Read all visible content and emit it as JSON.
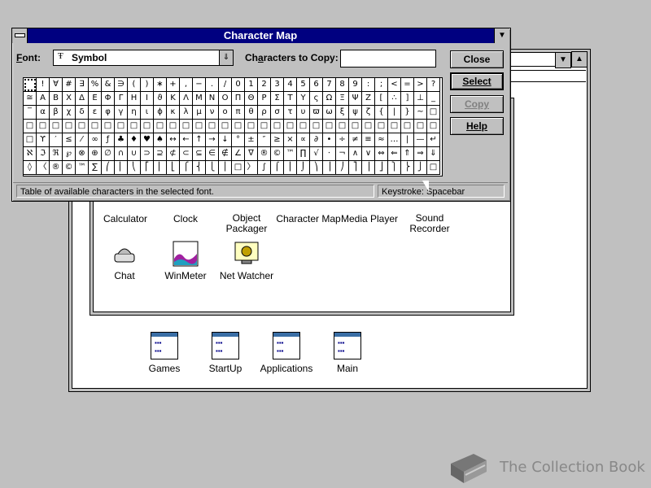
{
  "character_map": {
    "title": "Character Map",
    "font_label_prefix": "F",
    "font_label_rest": "ont:",
    "font_value": "Symbol",
    "font_icon": "truetype-icon",
    "copy_label_prefix": "Ch",
    "copy_label_u": "a",
    "copy_label_rest": "racters to Copy:",
    "copy_value": "",
    "buttons": {
      "close": "Close",
      "select": "Select",
      "copy": "Copy",
      "help": "Help"
    },
    "status": "Table of available characters in the selected font.",
    "keystroke": "Keystroke: Spacebar",
    "grid_rows": [
      [
        " ",
        "!",
        "∀",
        "#",
        "∃",
        "%",
        "&",
        "∋",
        "(",
        ")",
        "∗",
        "+",
        ",",
        "−",
        ".",
        "/",
        "0",
        "1",
        "2",
        "3",
        "4",
        "5",
        "6",
        "7",
        "8",
        "9",
        ":",
        ";",
        "<",
        "=",
        ">",
        "?"
      ],
      [
        "≅",
        "Α",
        "Β",
        "Χ",
        "Δ",
        "Ε",
        "Φ",
        "Γ",
        "Η",
        "Ι",
        "ϑ",
        "Κ",
        "Λ",
        "Μ",
        "Ν",
        "Ο",
        "Π",
        "Θ",
        "Ρ",
        "Σ",
        "Τ",
        "Υ",
        "ς",
        "Ω",
        "Ξ",
        "Ψ",
        "Ζ",
        "[",
        "∴",
        "]",
        "⊥",
        "_"
      ],
      [
        "‾",
        "α",
        "β",
        "χ",
        "δ",
        "ε",
        "φ",
        "γ",
        "η",
        "ι",
        "ϕ",
        "κ",
        "λ",
        "μ",
        "ν",
        "ο",
        "π",
        "θ",
        "ρ",
        "σ",
        "τ",
        "υ",
        "ϖ",
        "ω",
        "ξ",
        "ψ",
        "ζ",
        "{",
        "|",
        "}",
        "~",
        "□"
      ],
      [
        "□",
        "□",
        "□",
        "□",
        "□",
        "□",
        "□",
        "□",
        "□",
        "□",
        "□",
        "□",
        "□",
        "□",
        "□",
        "□",
        "□",
        "□",
        "□",
        "□",
        "□",
        "□",
        "□",
        "□",
        "□",
        "□",
        "□",
        "□",
        "□",
        "□",
        "□",
        "□"
      ],
      [
        "□",
        "ϒ",
        "′",
        "≤",
        "⁄",
        "∞",
        "ƒ",
        "♣",
        "♦",
        "♥",
        "♠",
        "↔",
        "←",
        "↑",
        "→",
        "↓",
        "°",
        "±",
        "″",
        "≥",
        "×",
        "∝",
        "∂",
        "•",
        "÷",
        "≠",
        "≡",
        "≈",
        "…",
        "|",
        "—",
        "↵"
      ],
      [
        "ℵ",
        "ℑ",
        "ℜ",
        "℘",
        "⊗",
        "⊕",
        "∅",
        "∩",
        "∪",
        "⊃",
        "⊇",
        "⊄",
        "⊂",
        "⊆",
        "∈",
        "∉",
        "∠",
        "∇",
        "®",
        "©",
        "™",
        "∏",
        "√",
        "⋅",
        "¬",
        "∧",
        "∨",
        "⇔",
        "⇐",
        "⇑",
        "⇒",
        "⇓"
      ],
      [
        "◊",
        "〈",
        "®",
        "©",
        "™",
        "∑",
        "⎛",
        "⎜",
        "⎝",
        "⎡",
        "⎢",
        "⎣",
        "⎧",
        "⎨",
        "⎩",
        "⎪",
        "□",
        "〉",
        "∫",
        "⌠",
        "⎮",
        "⌡",
        "⎞",
        "⎟",
        "⎠",
        "⎤",
        "⎥",
        "⎦",
        "⎫",
        "⎬",
        "⎭",
        "□"
      ]
    ]
  },
  "program_manager": {
    "accessories_icons": [
      {
        "label": "Calculator",
        "icon": "calculator-icon"
      },
      {
        "label": "Clock",
        "icon": "clock-icon"
      },
      {
        "label": "Object\nPackager",
        "icon": "object-packager-icon"
      },
      {
        "label": "Character Map",
        "icon": "character-map-icon"
      },
      {
        "label": "Media Player",
        "icon": "media-player-icon"
      },
      {
        "label": "Sound\nRecorder",
        "icon": "sound-recorder-icon"
      },
      {
        "label": "Chat",
        "icon": "chat-icon"
      },
      {
        "label": "WinMeter",
        "icon": "winmeter-icon"
      },
      {
        "label": "Net Watcher",
        "icon": "net-watcher-icon"
      }
    ],
    "groups": [
      {
        "label": "Games"
      },
      {
        "label": "StartUp"
      },
      {
        "label": "Applications"
      },
      {
        "label": "Main"
      }
    ]
  },
  "watermark": {
    "text": "The Collection Book",
    "icon": "book-icon"
  },
  "colors": {
    "desktop": "#c0c0c0",
    "titlebar": "#000080",
    "window": "#ffffff"
  }
}
